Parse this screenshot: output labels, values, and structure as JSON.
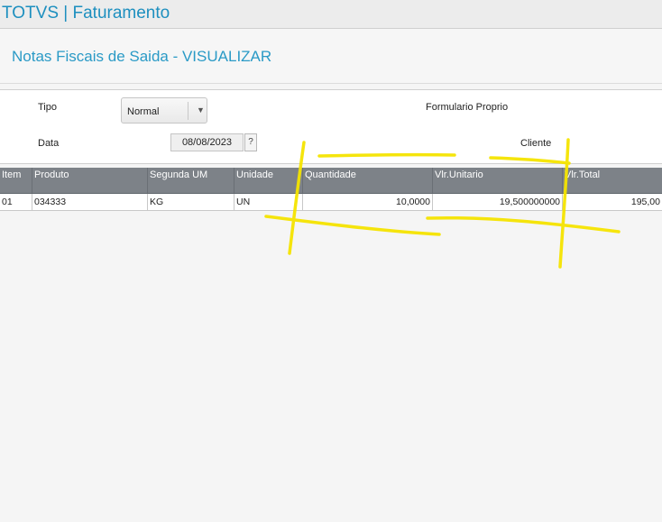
{
  "app": {
    "title": "TOTVS | Faturamento"
  },
  "page": {
    "title": "Notas Fiscais de Saida - VISUALIZAR"
  },
  "form": {
    "tipo_label": "Tipo",
    "tipo_value": "Normal",
    "formulario_label": "Formulario Proprio",
    "data_label": "Data",
    "data_value": "08/08/2023",
    "help_label": "?",
    "cliente_label": "Cliente"
  },
  "grid": {
    "columns": [
      "Item",
      "Produto",
      "Segunda UM",
      "Unidade",
      "Quantidade",
      "Vlr.Unitario",
      "Vlr.Total"
    ],
    "rows": [
      [
        "01",
        "034333",
        "KG",
        "UN",
        "10,0000",
        "19,500000000",
        "195,00"
      ]
    ]
  },
  "colors": {
    "title_blue": "#1d8fbf",
    "grid_header_bg": "#7d8288",
    "annotation_yellow": "#f5e400"
  }
}
